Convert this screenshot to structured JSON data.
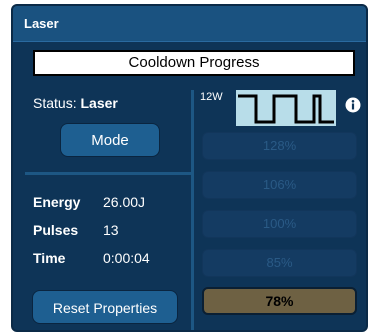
{
  "window": {
    "title": "Laser"
  },
  "cooldown": {
    "label": "Cooldown Progress"
  },
  "status": {
    "label": "Status:",
    "value": "Laser"
  },
  "buttons": {
    "mode_label": "Mode",
    "reset_label": "Reset Properties"
  },
  "stats": [
    {
      "label": "Energy",
      "value": "26.00J"
    },
    {
      "label": "Pulses",
      "value": "13"
    },
    {
      "label": "Time",
      "value": "0:00:04"
    }
  ],
  "power": {
    "label": "12W"
  },
  "levels": [
    {
      "label": "128%",
      "active": false
    },
    {
      "label": "106%",
      "active": false
    },
    {
      "label": "100%",
      "active": false
    },
    {
      "label": "85%",
      "active": false
    },
    {
      "label": "78%",
      "active": true
    }
  ],
  "icons": {
    "info": "info-icon",
    "waveform": "square-wave-icon"
  },
  "colors": {
    "panel_bg": "#0e3457",
    "titlebar_bg": "#1a5280",
    "button_bg": "#1e5f91",
    "level_inactive_bg": "#143b62",
    "level_active_bg": "#6e6143",
    "waveform_bg": "#b8dde9"
  }
}
